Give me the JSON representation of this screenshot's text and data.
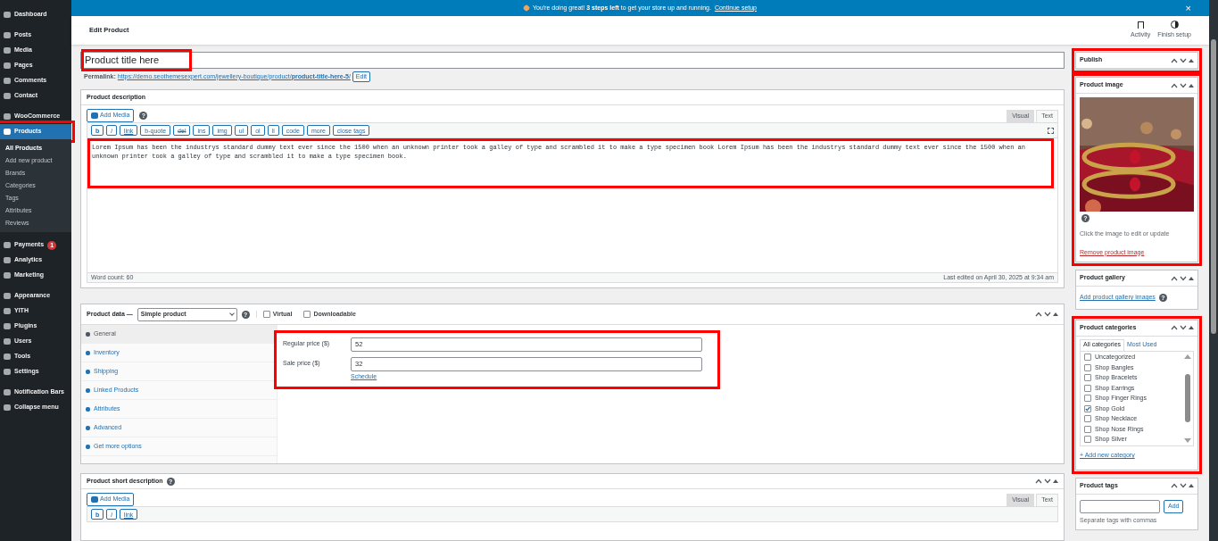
{
  "sidebar": {
    "sections": [
      {
        "items": [
          {
            "label": "Dashboard",
            "selected": false
          }
        ]
      },
      {
        "items": [
          {
            "label": "Posts",
            "selected": false
          },
          {
            "label": "Media",
            "selected": false
          },
          {
            "label": "Pages",
            "selected": false
          },
          {
            "label": "Comments",
            "selected": false
          },
          {
            "label": "Contact",
            "selected": false
          }
        ]
      },
      {
        "items": [
          {
            "label": "WooCommerce",
            "selected": false
          },
          {
            "label": "Products",
            "selected": true,
            "highlighted": true,
            "children": [
              {
                "label": "All Products",
                "selected": true
              },
              {
                "label": "Add new product",
                "selected": false
              },
              {
                "label": "Brands",
                "selected": false
              },
              {
                "label": "Categories",
                "selected": false
              },
              {
                "label": "Tags",
                "selected": false
              },
              {
                "label": "Attributes",
                "selected": false
              },
              {
                "label": "Reviews",
                "selected": false
              }
            ]
          }
        ]
      },
      {
        "items": [
          {
            "label": "Payments",
            "selected": false,
            "badge": "1"
          },
          {
            "label": "Analytics",
            "selected": false
          },
          {
            "label": "Marketing",
            "selected": false
          }
        ]
      },
      {
        "items": [
          {
            "label": "Appearance",
            "selected": false
          },
          {
            "label": "YITH",
            "selected": false
          },
          {
            "label": "Plugins",
            "selected": false
          },
          {
            "label": "Users",
            "selected": false
          },
          {
            "label": "Tools",
            "selected": false
          },
          {
            "label": "Settings",
            "selected": false
          }
        ]
      },
      {
        "items": [
          {
            "label": "Notification Bars",
            "selected": false
          },
          {
            "label": "Collapse menu",
            "selected": false
          }
        ]
      }
    ]
  },
  "notice": {
    "text": "You're doing great! **3 steps left** to get your store up and running.",
    "link": "Continue setup",
    "close": "×"
  },
  "header": {
    "title": "Edit Product",
    "actions": [
      {
        "label": "Activity",
        "kind": "flag"
      },
      {
        "label": "Finish setup",
        "kind": "progress"
      }
    ]
  },
  "title_field": {
    "value": "Product title here",
    "highlighted": true
  },
  "permalink": {
    "label": "Permalink:",
    "url": "https://demo.seothemesexpert.com/jewellery-boutique/product/",
    "slug": "product-title-here-5",
    "trail": "/",
    "button": "Edit"
  },
  "description": {
    "title": "Product description",
    "add_media": "Add Media",
    "help": "?",
    "tabs": [
      {
        "label": "Visual",
        "selected": true
      },
      {
        "label": "Text",
        "selected": false
      }
    ],
    "toolbar": [
      "b",
      "i",
      "link",
      "b-quote",
      "del",
      "ins",
      "img",
      "ul",
      "ol",
      "li",
      "code",
      "more",
      "close tags"
    ],
    "content": "Lorem Ipsum has been the industrys standard dummy text ever since the 1500 when an unknown printer took a galley of type and scrambled it to make a type specimen book Lorem Ipsum has been the industrys standard dummy text ever since the 1500 when an unknown printer took a galley of type and scrambled it to make a type specimen book.",
    "highlighted": true,
    "word_count": "Word count: 60",
    "last_edited": "Last edited on April 30, 2025 at 9:34 am"
  },
  "product_data": {
    "title": "Product data —",
    "type": "Simple product",
    "help": "?",
    "options": [
      {
        "label": "Virtual",
        "checked": false
      },
      {
        "label": "Downloadable",
        "checked": false
      }
    ],
    "tabs": [
      {
        "label": "General",
        "selected": true
      },
      {
        "label": "Inventory",
        "selected": false
      },
      {
        "label": "Shipping",
        "selected": false
      },
      {
        "label": "Linked Products",
        "selected": false
      },
      {
        "label": "Attributes",
        "selected": false
      },
      {
        "label": "Advanced",
        "selected": false
      },
      {
        "label": "Get more options",
        "selected": false
      }
    ],
    "fields": [
      {
        "label": "Regular price ($)",
        "value": "52"
      },
      {
        "label": "Sale price ($)",
        "value": "32",
        "link": "Schedule"
      }
    ],
    "highlighted": true
  },
  "short_description": {
    "title": "Product short description",
    "help": "?",
    "add_media": "Add Media",
    "tabs": [
      {
        "label": "Visual",
        "selected": true
      },
      {
        "label": "Text",
        "selected": false
      }
    ],
    "toolbar": [
      "b",
      "i",
      "link"
    ]
  },
  "publish": {
    "title": "Publish",
    "highlighted": true
  },
  "product_image": {
    "title": "Product image",
    "help": "?",
    "hint": "Click the image to edit or update",
    "remove": "Remove product image",
    "highlighted": true
  },
  "gallery": {
    "title": "Product gallery",
    "link": "Add product gallery images",
    "help": "?"
  },
  "categories": {
    "title": "Product categories",
    "tabs": [
      {
        "label": "All categories",
        "selected": true
      },
      {
        "label": "Most Used",
        "selected": false
      }
    ],
    "items": [
      {
        "label": "Uncategorized",
        "checked": false
      },
      {
        "label": "Shop Bangles",
        "checked": false
      },
      {
        "label": "Shop Bracelets",
        "checked": false
      },
      {
        "label": "Shop Earrings",
        "checked": false
      },
      {
        "label": "Shop Finger Rings",
        "checked": false
      },
      {
        "label": "Shop Gold",
        "checked": true
      },
      {
        "label": "Shop Necklace",
        "checked": false
      },
      {
        "label": "Shop Nose Rings",
        "checked": false
      },
      {
        "label": "Shop Silver",
        "checked": false
      }
    ],
    "add_link": "+ Add new category",
    "highlighted": true
  },
  "tags": {
    "title": "Product tags",
    "button": "Add",
    "hint": "Separate tags with commas"
  }
}
